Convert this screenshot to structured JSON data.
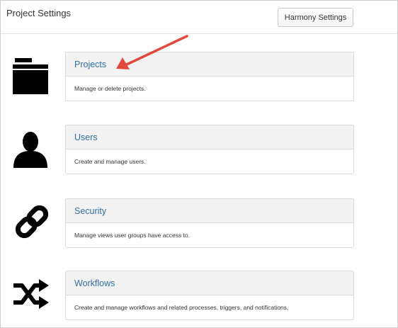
{
  "header": {
    "title": "Project Settings",
    "harmony_button": "Harmony Settings"
  },
  "sections": [
    {
      "icon": "folder-icon",
      "title": "Projects",
      "description": "Manage or delete projects."
    },
    {
      "icon": "user-icon",
      "title": "Users",
      "description": "Create and manage users."
    },
    {
      "icon": "link-icon",
      "title": "Security",
      "description": "Manage views user groups have access to."
    },
    {
      "icon": "shuffle-icon",
      "title": "Workflows",
      "description": "Create and manage workflows and related processes, triggers, and notifications."
    }
  ],
  "colors": {
    "link": "#2f6fa7",
    "annotation_arrow": "#e2493d",
    "card_header": "#f2f2f2"
  }
}
